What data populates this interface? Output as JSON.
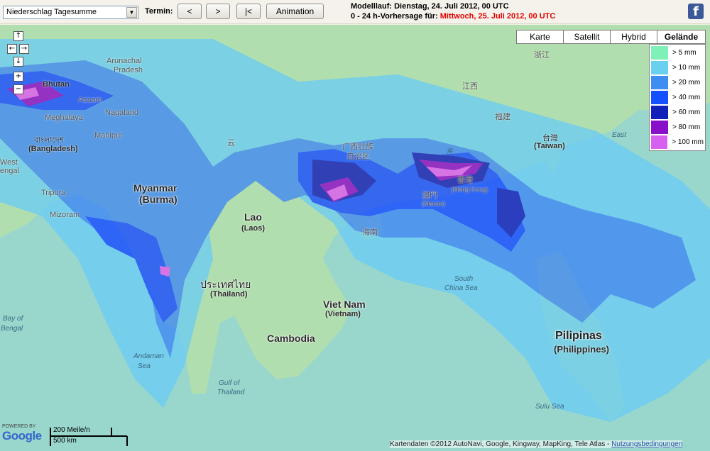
{
  "toolbar": {
    "product_select": "Niederschlag Tagesumme",
    "termin_label": "Termin:",
    "prev_button": "<",
    "next_button": ">",
    "first_button": "|<",
    "animation_button": "Animation",
    "modelllauf": "Modelllauf: Dienstag, 24. Juli 2012, 00 UTC",
    "forecast_prefix": "0 - 24 h-Vorhersage für: ",
    "forecast_date": "Mittwoch, 25. Juli 2012, 00 UTC",
    "facebook": "f"
  },
  "nav": {
    "up": "↑",
    "left": "←",
    "right": "→",
    "down": "↓",
    "zoom_in": "+",
    "zoom_out": "−"
  },
  "map_types": [
    "Karte",
    "Satellit",
    "Hybrid",
    "Gelände"
  ],
  "active_map_type": "Gelände",
  "legend": [
    {
      "label": "> 5 mm",
      "color": "#7ff0b8"
    },
    {
      "label": "> 10 mm",
      "color": "#6ad0f0"
    },
    {
      "label": "> 20 mm",
      "color": "#3e8ef2"
    },
    {
      "label": "> 40 mm",
      "color": "#1450ff"
    },
    {
      "label": "> 60 mm",
      "color": "#1020b8"
    },
    {
      "label": "> 80 mm",
      "color": "#8810c8"
    },
    {
      "label": "> 100 mm",
      "color": "#d860f0"
    }
  ],
  "labels": {
    "arunachal": "Arunachal",
    "pradesh": "Pradesh",
    "bhutan": "Bhutan",
    "assam": "Assam",
    "meghalaya": "Meghalaya",
    "nagaland": "Nagaland",
    "manipur": "Manipur",
    "bangladesh_native": "বাংলাদেশ",
    "bangladesh": "(Bangladesh)",
    "west": "West",
    "bengal": "engal",
    "tripura": "Tripura",
    "mizoram": "Mizoram",
    "myanmar": "Myanmar",
    "burma": "(Burma)",
    "yunnan": "云",
    "laos": "Lao",
    "laos_sub": "(Laos)",
    "thailand_native": "ประเทศไทย",
    "thailand": "(Thailand)",
    "vietnam": "Viet Nam",
    "vietnam_sub": "(Vietnam)",
    "cambodia": "Cambodia",
    "guangxi": "广西壮族",
    "guangxi2": "自治区",
    "hainan": "海南",
    "zhejiang": "浙江",
    "jiangxi": "江西",
    "fujian": "福建",
    "taiwan_native": "台灣",
    "taiwan": "(Taiwan)",
    "hongkong_native": "香港",
    "hongkong": "(Hong Kong)",
    "macau_native": "澳門",
    "macau": "(Macau)",
    "east": "East",
    "dong": "东",
    "south_china_sea": "South",
    "south_china_sea2": "China Sea",
    "pilipinas": "Pilipinas",
    "philippines": "(Philippines)",
    "bay_of": "Bay of",
    "bengal_sea": "Bengal",
    "andaman": "Andaman",
    "andaman_sea": "Sea",
    "gulf_of": "Gulf of",
    "thailand_gulf": "Thailand",
    "sulu": "Sulu Sea"
  },
  "scale": {
    "miles": "200 Meile/n",
    "km": "500 km"
  },
  "google": {
    "powered_by": "POWERED BY",
    "logo": "Google"
  },
  "copyright": {
    "text": "Kartendaten ©2012 AutoNavi, Google, Kingway, MapKing, Tele Atlas - ",
    "link": "Nutzungsbedingungen"
  }
}
